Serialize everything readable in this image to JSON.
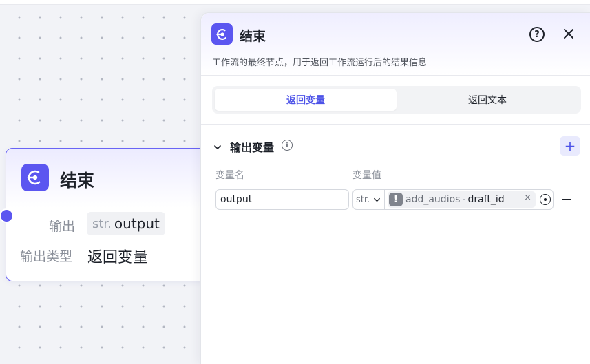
{
  "node": {
    "title": "结束",
    "icon": "end-node-icon",
    "output_label": "输出",
    "output_type_badge": "str.",
    "output_name": "output",
    "output_kind_label": "输出类型",
    "output_kind_value": "返回变量"
  },
  "panel": {
    "title": "结束",
    "icon": "end-node-icon",
    "description": "工作流的最终节点，用于返回工作流运行后的结果信息",
    "tabs": [
      {
        "label": "返回变量",
        "active": true
      },
      {
        "label": "返回文本",
        "active": false
      }
    ],
    "section": {
      "title": "输出变量",
      "col_name": "变量名",
      "col_value": "变量值"
    },
    "row": {
      "name": "output",
      "type": "str.",
      "ref_node": "add_audios",
      "ref_sep": "-",
      "ref_var": "draft_id",
      "clear": "×",
      "warning": "!"
    }
  },
  "colors": {
    "accent": "#5b56f0",
    "tab_active_text": "#4d53e8",
    "canvas_bg": "#f2f3f7"
  }
}
